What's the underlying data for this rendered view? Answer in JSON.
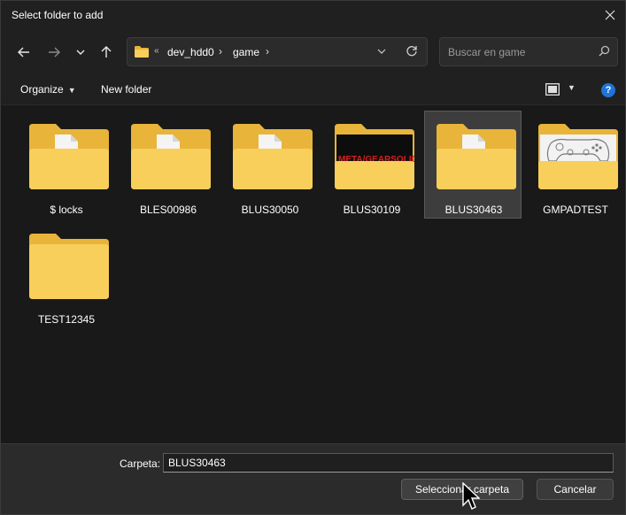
{
  "window": {
    "title": "Select folder to add"
  },
  "nav": {
    "breadcrumbs": [
      "dev_hdd0",
      "game"
    ]
  },
  "search": {
    "placeholder": "Buscar en game"
  },
  "toolbar": {
    "organize_label": "Organize",
    "new_folder_label": "New folder"
  },
  "items": [
    {
      "name": "$ locks",
      "thumb": "document"
    },
    {
      "name": "BLES00986",
      "thumb": "document"
    },
    {
      "name": "BLUS30050",
      "thumb": "document"
    },
    {
      "name": "BLUS30109",
      "thumb": "banner"
    },
    {
      "name": "BLUS30463",
      "thumb": "document",
      "selected": true
    },
    {
      "name": "GMPADTEST",
      "thumb": "controller"
    },
    {
      "name": "TEST12345",
      "thumb": "empty"
    }
  ],
  "banner_text": "META/GEARSOLID",
  "footer": {
    "folder_label": "Carpeta:",
    "folder_value": "BLUS30463",
    "select_label": "Seleccionar carpeta",
    "cancel_label": "Cancelar"
  },
  "colors": {
    "accent": "#1e74d8",
    "folder_back": "#e8b43a",
    "folder_front": "#f7cf5a",
    "banner_text": "#d81e1e"
  }
}
